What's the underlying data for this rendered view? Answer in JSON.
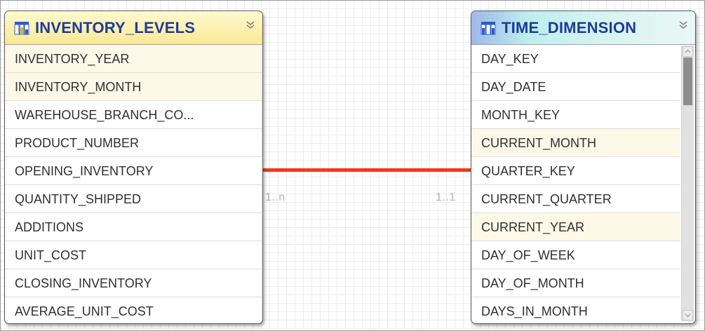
{
  "entities": {
    "inventory": {
      "title": "INVENTORY_LEVELS",
      "icon": "table-icon",
      "columns": [
        {
          "name": "INVENTORY_YEAR",
          "key": true
        },
        {
          "name": "INVENTORY_MONTH",
          "key": true
        },
        {
          "name": "WAREHOUSE_BRANCH_CO...",
          "key": false
        },
        {
          "name": "PRODUCT_NUMBER",
          "key": false
        },
        {
          "name": "OPENING_INVENTORY",
          "key": false
        },
        {
          "name": "QUANTITY_SHIPPED",
          "key": false
        },
        {
          "name": "ADDITIONS",
          "key": false
        },
        {
          "name": "UNIT_COST",
          "key": false
        },
        {
          "name": "CLOSING_INVENTORY",
          "key": false
        },
        {
          "name": "AVERAGE_UNIT_COST",
          "key": false
        }
      ]
    },
    "time": {
      "title": "TIME_DIMENSION",
      "icon": "table-icon",
      "columns": [
        {
          "name": "DAY_KEY",
          "key": false
        },
        {
          "name": "DAY_DATE",
          "key": false
        },
        {
          "name": "MONTH_KEY",
          "key": false
        },
        {
          "name": "CURRENT_MONTH",
          "key": true
        },
        {
          "name": "QUARTER_KEY",
          "key": false
        },
        {
          "name": "CURRENT_QUARTER",
          "key": false
        },
        {
          "name": "CURRENT_YEAR",
          "key": true
        },
        {
          "name": "DAY_OF_WEEK",
          "key": false
        },
        {
          "name": "DAY_OF_MONTH",
          "key": false
        },
        {
          "name": "DAYS_IN_MONTH",
          "key": false
        }
      ]
    }
  },
  "relationship": {
    "left_cardinality": "1..n",
    "right_cardinality": "1..1",
    "color": "#ea3c1f"
  },
  "colors": {
    "title_text": "#1f3b9a",
    "key_row": "#fdf8e8"
  }
}
